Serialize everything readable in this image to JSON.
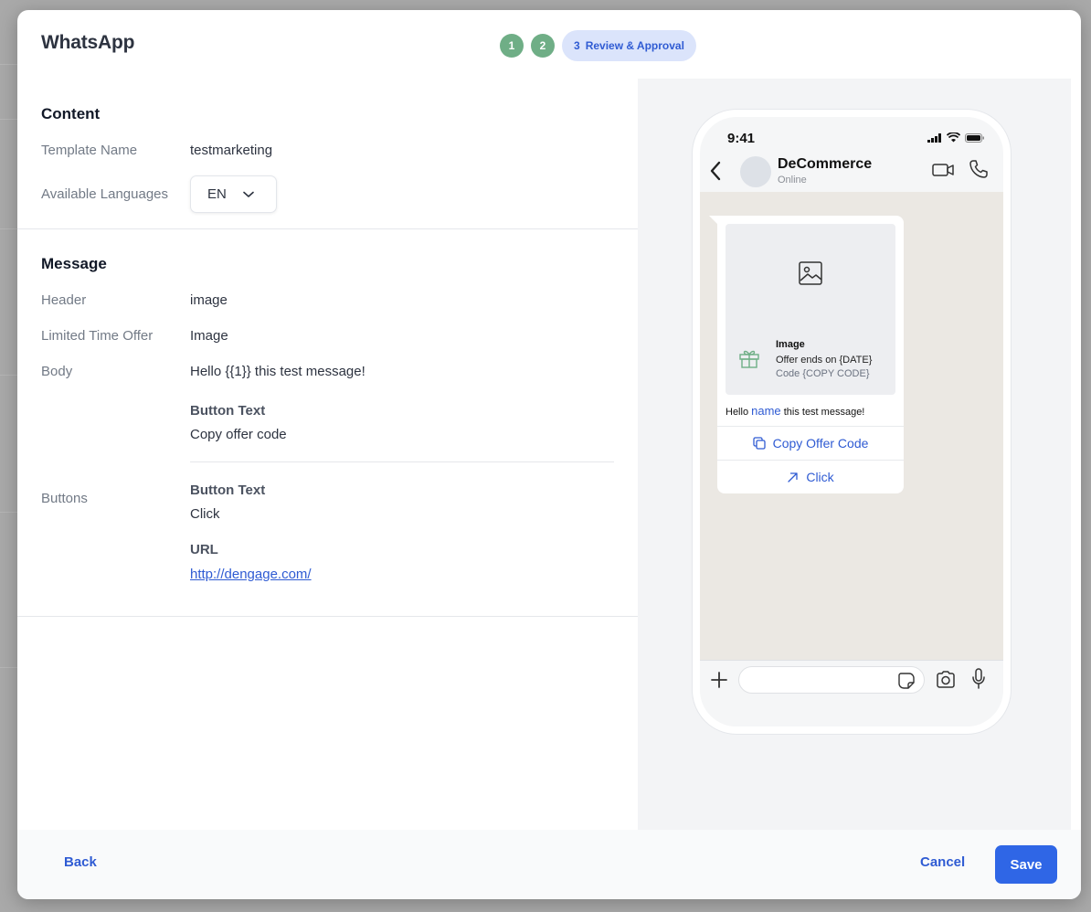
{
  "modal": {
    "title": "WhatsApp"
  },
  "stepper": {
    "steps": [
      {
        "number": "1",
        "state": "done"
      },
      {
        "number": "2",
        "state": "done"
      },
      {
        "number": "3",
        "label": "Review & Approval",
        "state": "current"
      }
    ]
  },
  "content": {
    "section_title": "Content",
    "template_name_label": "Template Name",
    "template_name_value": "testmarketing",
    "languages_label": "Available Languages",
    "language_selected": "EN"
  },
  "message": {
    "section_title": "Message",
    "header_label": "Header",
    "header_value": "image",
    "limited_offer_label": "Limited Time Offer",
    "limited_offer_value": "Image",
    "body_label": "Body",
    "body_value": "Hello {{1}} this test message!",
    "copy_button_heading": "Button Text",
    "copy_button_value": "Copy offer code",
    "buttons_label": "Buttons",
    "click_button_heading": "Button Text",
    "click_button_value": "Click",
    "url_heading": "URL",
    "url_value": "http://dengage.com/"
  },
  "preview": {
    "time": "9:41",
    "contact_name": "DeCommerce",
    "contact_status": "Online",
    "offer_title": "Image",
    "offer_line1": "Offer ends on {DATE}",
    "offer_line2": "Code {COPY CODE}",
    "body_prefix": "Hello ",
    "body_variable": "name",
    "body_suffix": " this test message!",
    "copy_button": "Copy Offer Code",
    "click_button": "Click"
  },
  "footer": {
    "back_label": "Back",
    "cancel_label": "Cancel",
    "save_label": "Save"
  },
  "colors": {
    "primary": "#2f66e6",
    "step_done": "#6fae86",
    "step_current_bg": "#dbe4fb",
    "gift_icon": "#6fae86"
  },
  "icons": [
    "chevron-down-icon",
    "back-arrow-icon",
    "video-call-icon",
    "phone-call-icon",
    "image-placeholder-icon",
    "gift-icon",
    "copy-icon",
    "external-link-icon",
    "plus-icon",
    "sticker-icon",
    "camera-icon",
    "microphone-icon",
    "signal-icon",
    "wifi-icon",
    "battery-icon"
  ]
}
